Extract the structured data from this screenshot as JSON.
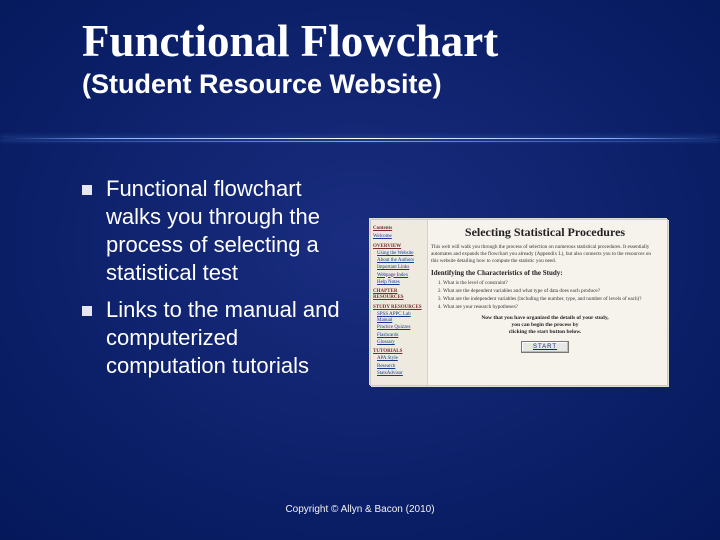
{
  "title": "Functional Flowchart",
  "subtitle": "(Student Resource Website)",
  "bullets": [
    "Functional flowchart walks you through the process of selecting a statistical test",
    "Links to the manual and computerized computation tutorials"
  ],
  "thumb": {
    "sidebar": {
      "heading_contents": "Contents",
      "link_welcome": "Welcome",
      "heading_overview": "OVERVIEW",
      "link_using": "Using the Website",
      "link_about": "About the Authors",
      "link_important_links": "Important Links",
      "link_webpage_index": "Webpage Index",
      "link_help_notes": "Help Notes",
      "heading_chapter": "CHAPTER RESOURCES",
      "heading_study": "STUDY RESOURCES",
      "link_spss_appc": "SPSS APPC Lab Manual",
      "link_practice_quizzes": "Practice Quizzes",
      "link_flashcards": "Flashcards",
      "link_glossary": "Glossary",
      "heading_tutorials": "TUTORIALS",
      "link_apa": "APA Style",
      "link_research": "Research",
      "link_stats_adv": "StatsAdvisor"
    },
    "title": "Selecting Statistical Procedures",
    "intro": "This web will walk you through the process of selection on numerous statistical procedures. It essentially automates and expands the flowchart you already (Appendix L), but also connects you to the resources on this website detailing how to compute the statistic you need.",
    "section_heading": "Identifying the Characteristics of the Study:",
    "questions": [
      "What is the level of constraint?",
      "What are the dependent variables and what type of data does each produce?",
      "What are the independent variables (including the number, type, and number of levels of each)?",
      "What are your research hypotheses?"
    ],
    "cta_line1": "Now that you have organized the details of your study,",
    "cta_line2": "you can begin the process by",
    "cta_line3": "clicking the start button below.",
    "start": "START"
  },
  "copyright": "Copyright © Allyn & Bacon (2010)"
}
